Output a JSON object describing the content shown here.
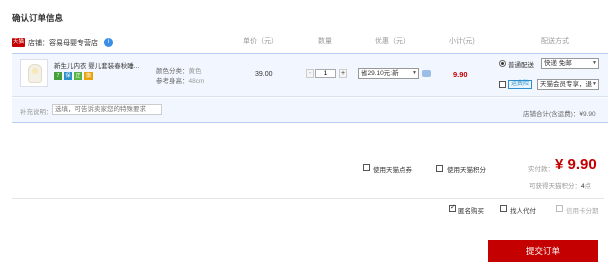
{
  "page": {
    "title": "确认订单信息"
  },
  "columns": {
    "unit_price": "单价（元）",
    "quantity": "数量",
    "discount": "优惠（元）",
    "subtotal": "小计(元)",
    "shipping": "配送方式"
  },
  "shop": {
    "badge": "天猫",
    "label": "店铺：",
    "name": "容易母婴专营店",
    "info_icon": "info-icon"
  },
  "item": {
    "title": "新生儿内衣 婴儿套装春秋睡...",
    "badges": [
      "7",
      "保",
      "正",
      "旗"
    ],
    "color_label": "颜色分类：",
    "color_value": "黄色",
    "height_label": "参考身高：",
    "height_value": "48cm",
    "unit_price": "39.00",
    "quantity": "1",
    "qty_minus": "-",
    "qty_plus": "+",
    "discount_option": "省29.10元:新",
    "subtotal": "9.90"
  },
  "shipping": {
    "method_label": "普通配送",
    "method_selected": true,
    "method_option": "快递 免邮",
    "insurance_checked": false,
    "insurance_badge": "运费险",
    "insurance_option": "天猫会员专享，退"
  },
  "remark": {
    "label": "补充说明：",
    "placeholder": "选填，可告诉卖家您的特殊要求"
  },
  "shop_total": {
    "label": "店铺合计(含运费)：",
    "value": "¥9.90"
  },
  "options": {
    "tmall_coupon": "使用天猫点券",
    "tmall_points": "使用天猫积分"
  },
  "payment": {
    "paid_label": "实付款：",
    "amount": "¥ 9.90",
    "points_label": "可获得天猫积分：",
    "points_value": "4",
    "points_unit": "点"
  },
  "footer": {
    "anonymous_label": "匿名购买",
    "anonymous_checked": true,
    "proxy_label": "找人代付",
    "proxy_checked": false,
    "card_label": "信用卡分期",
    "card_checked": false,
    "submit_label": "提交订单"
  },
  "colors": {
    "accent_red": "#c40000",
    "row_bg": "#f2f7ff",
    "row_border": "#b8d0ee"
  }
}
